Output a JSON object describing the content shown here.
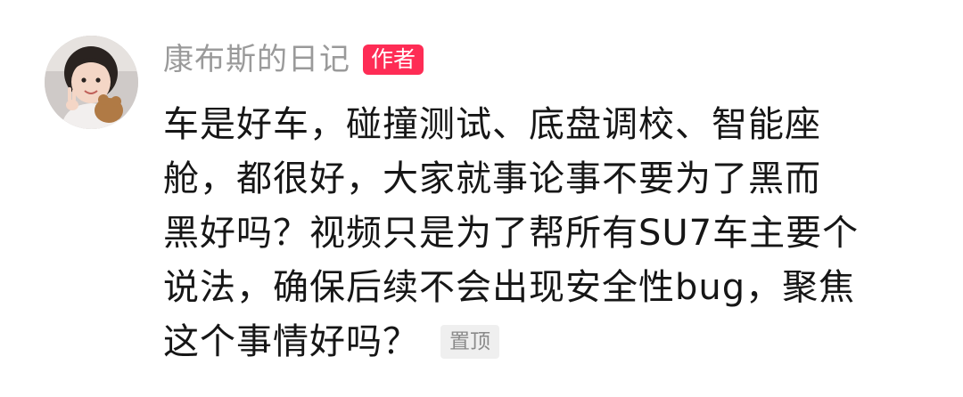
{
  "comment": {
    "author": {
      "name": "康布斯的日记",
      "badge": "作者",
      "avatar_icon": "child-with-plush-toy-avatar",
      "badge_color": "#fe2c55"
    },
    "text_lines": [
      "车是好车，碰撞测试、底盘调校、智能座",
      "舱，都很好，大家就事论事不要为了黑而",
      "黑好吗？视频只是为了帮所有SU7车主要个",
      "说法，确保后续不会出现安全性bug，聚焦",
      "这个事情好吗？"
    ],
    "pinned_label": "置顶"
  }
}
